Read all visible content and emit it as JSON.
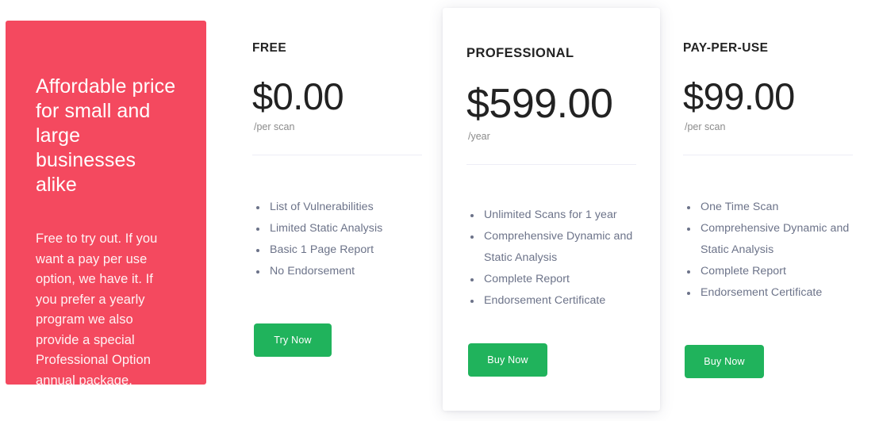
{
  "promo": {
    "title": "Affordable price for small and large businesses alike",
    "body": "Free to try out. If you want a pay per use option, we have it. If you prefer a yearly program we also provide a special Professional Option annual package.",
    "background_color": "#f4495f"
  },
  "accent": {
    "cta_color": "#20b35c",
    "divider_color": "#eeeef6",
    "feature_text_color": "#6c7389"
  },
  "plans": [
    {
      "name": "FREE",
      "price": "$0.00",
      "period": "/per scan",
      "features": [
        "List of Vulnerabilities",
        "Limited Static Analysis",
        "Basic 1 Page Report",
        "No Endorsement"
      ],
      "cta_label": "Try Now",
      "featured": false
    },
    {
      "name": "PROFESSIONAL",
      "price": "$599.00",
      "period": "/year",
      "features": [
        "Unlimited Scans for 1 year",
        "Comprehensive Dynamic and Static Analysis",
        "Complete Report",
        "Endorsement Certificate"
      ],
      "cta_label": "Buy Now",
      "featured": true
    },
    {
      "name": "PAY-PER-USE",
      "price": "$99.00",
      "period": "/per scan",
      "features": [
        "One Time Scan",
        "Comprehensive Dynamic and Static Analysis",
        "Complete Report",
        "Endorsement Certificate"
      ],
      "cta_label": "Buy Now",
      "featured": false
    }
  ]
}
